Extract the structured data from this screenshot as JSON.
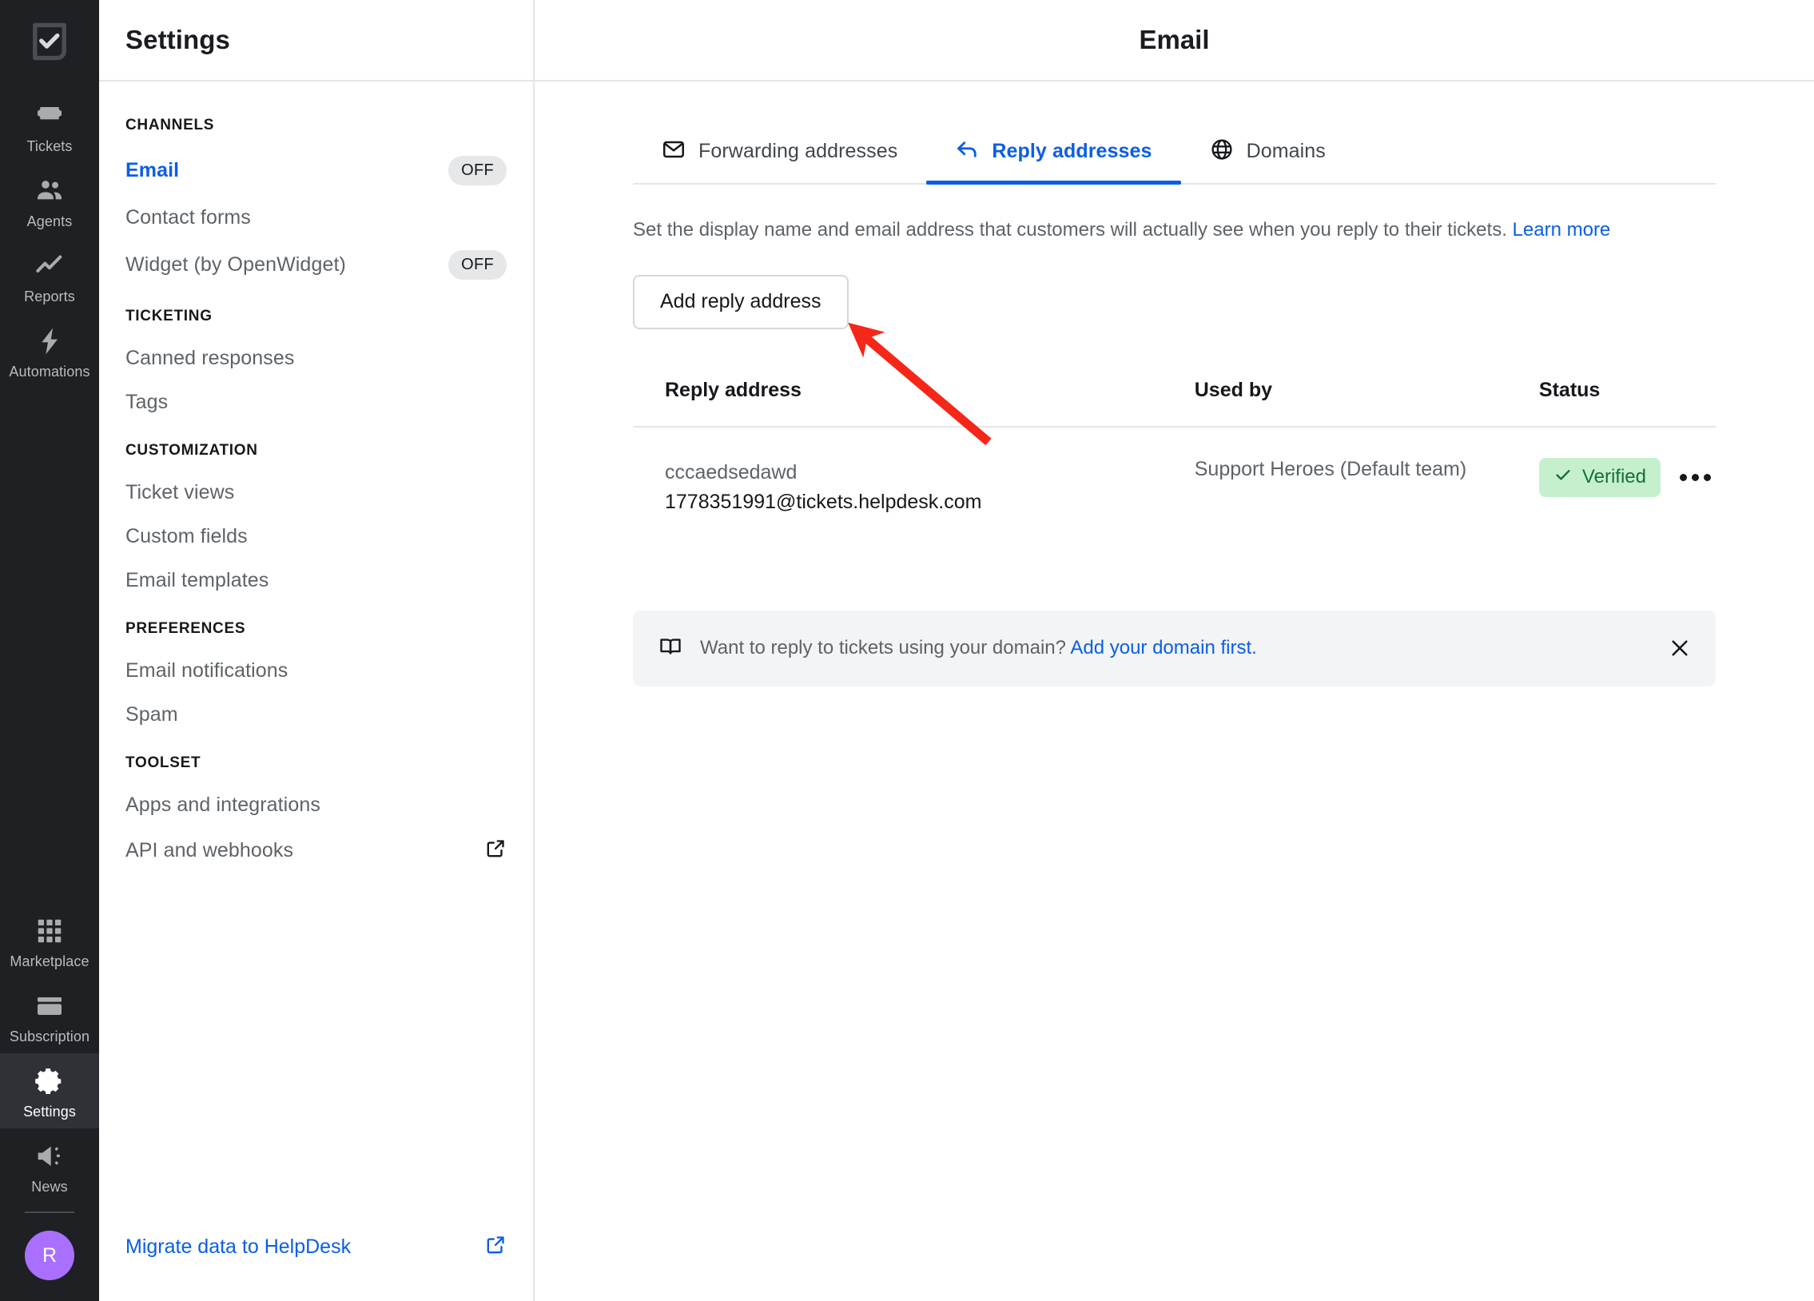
{
  "rail": {
    "logo_icon": "helpdesk-checkbox-logo",
    "items": [
      {
        "label": "Tickets",
        "icon": "ticket-icon",
        "active": false
      },
      {
        "label": "Agents",
        "icon": "agents-icon",
        "active": false
      },
      {
        "label": "Reports",
        "icon": "reports-icon",
        "active": false
      },
      {
        "label": "Automations",
        "icon": "automations-icon",
        "active": false
      },
      {
        "label": "Marketplace",
        "icon": "marketplace-icon",
        "active": false
      },
      {
        "label": "Subscription",
        "icon": "subscription-icon",
        "active": false
      },
      {
        "label": "Settings",
        "icon": "gear-icon",
        "active": true
      },
      {
        "label": "News",
        "icon": "megaphone-icon",
        "active": false
      }
    ],
    "avatar_initial": "R",
    "avatar_color": "#a970ff"
  },
  "sidebar": {
    "title": "Settings",
    "groups": [
      {
        "label": "CHANNELS",
        "items": [
          {
            "label": "Email",
            "badge": "OFF",
            "active": true
          },
          {
            "label": "Contact forms",
            "badge": "",
            "active": false
          },
          {
            "label": "Widget (by OpenWidget)",
            "badge": "OFF",
            "active": false
          }
        ]
      },
      {
        "label": "TICKETING",
        "items": [
          {
            "label": "Canned responses",
            "badge": "",
            "active": false
          },
          {
            "label": "Tags",
            "badge": "",
            "active": false
          }
        ]
      },
      {
        "label": "CUSTOMIZATION",
        "items": [
          {
            "label": "Ticket views",
            "badge": "",
            "active": false
          },
          {
            "label": "Custom fields",
            "badge": "",
            "active": false
          },
          {
            "label": "Email templates",
            "badge": "",
            "active": false
          }
        ]
      },
      {
        "label": "PREFERENCES",
        "items": [
          {
            "label": "Email notifications",
            "badge": "",
            "active": false
          },
          {
            "label": "Spam",
            "badge": "",
            "active": false
          }
        ]
      },
      {
        "label": "TOOLSET",
        "items": [
          {
            "label": "Apps and integrations",
            "badge": "",
            "active": false
          },
          {
            "label": "API and webhooks",
            "badge": "",
            "external": true,
            "active": false
          }
        ]
      }
    ],
    "migrate_label": "Migrate data to HelpDesk",
    "migrate_icon": "external-link-icon"
  },
  "header": {
    "title": "Email"
  },
  "tabs": [
    {
      "label": "Forwarding addresses",
      "icon": "envelope-icon",
      "active": false
    },
    {
      "label": "Reply addresses",
      "icon": "reply-arrow-icon",
      "active": true
    },
    {
      "label": "Domains",
      "icon": "globe-icon",
      "active": false
    }
  ],
  "description": {
    "text": "Set the display name and email address that customers will actually see when you reply to their tickets.",
    "link": "Learn more"
  },
  "add_button": {
    "label": "Add reply address"
  },
  "table": {
    "columns": [
      "Reply address",
      "Used by",
      "Status"
    ],
    "rows": [
      {
        "display_name": "cccaedsedawd",
        "email": "1778351991@tickets.helpdesk.com",
        "used_by": "Support Heroes (Default team)",
        "status": "Verified",
        "status_icon": "check-icon",
        "menu_icon": "kebab-menu-icon"
      }
    ]
  },
  "banner": {
    "icon": "book-icon",
    "text": "Want to reply to tickets using your domain?",
    "link": "Add your domain first.",
    "close_icon": "close-icon"
  },
  "colors": {
    "accent": "#0a5ee7",
    "rail_bg": "#1f2023",
    "rail_active_bg": "#303136",
    "badge_verified_bg": "#c6f0cd",
    "badge_verified_text": "#14703a",
    "annotation": "#f42718"
  },
  "annotation": {
    "type": "arrow",
    "color": "#f42718",
    "points_to": "add-reply-address-button"
  }
}
